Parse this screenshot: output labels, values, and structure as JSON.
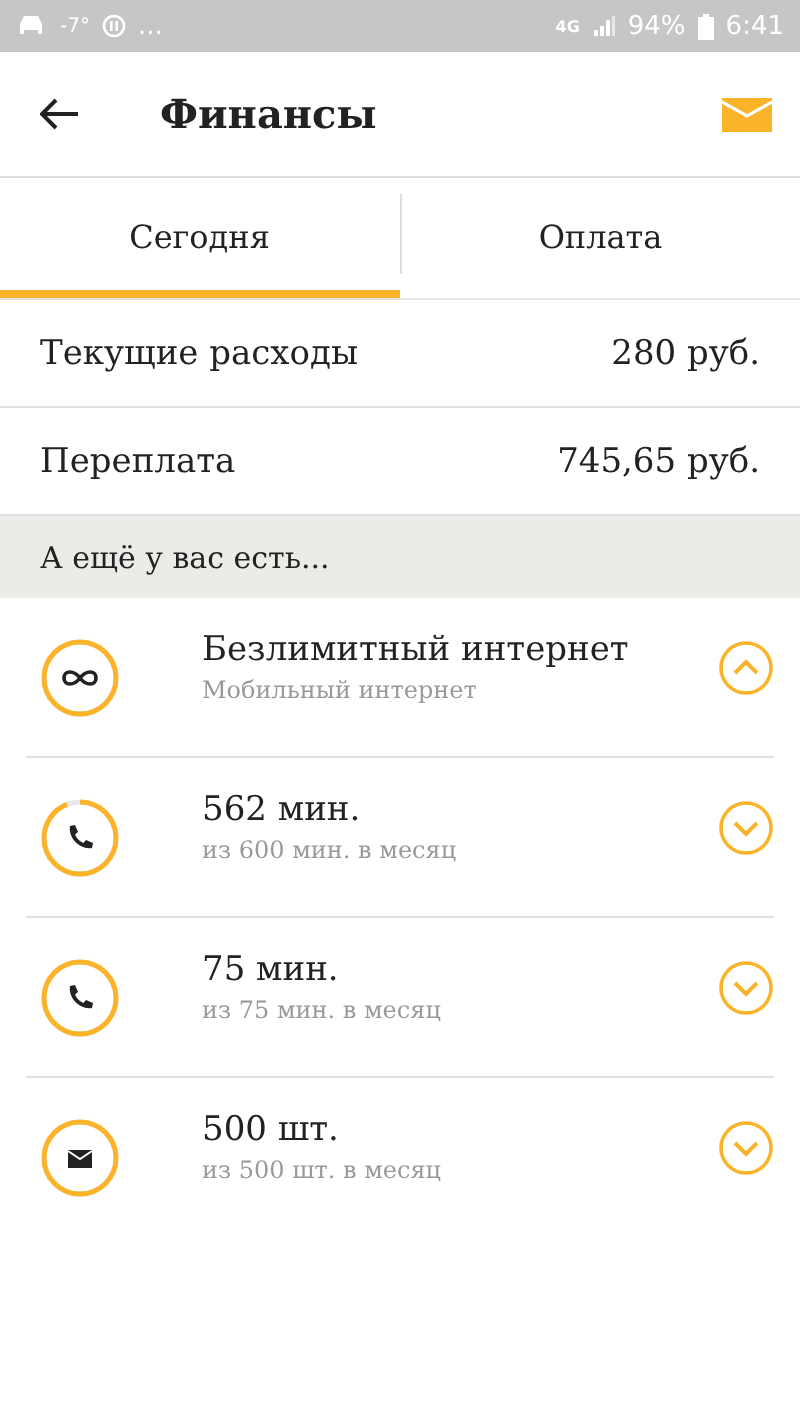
{
  "status_bar": {
    "temperature": "-7°",
    "more": "...",
    "network": "4G",
    "battery": "94%",
    "time": "6:41"
  },
  "app_bar": {
    "title": "Финансы"
  },
  "tabs": [
    {
      "label": "Сегодня",
      "selected": true
    },
    {
      "label": "Оплата",
      "selected": false
    }
  ],
  "summary": [
    {
      "label": "Текущие расходы",
      "value": "280 руб."
    },
    {
      "label": "Переплата",
      "value": "745,65 руб."
    }
  ],
  "section_header": "А ещё у вас есть...",
  "packages": [
    {
      "kind": "infinity",
      "title": "Безлимитный интернет",
      "subtitle": "Мобильный интернет",
      "level": 1,
      "expanded": true
    },
    {
      "kind": "phone",
      "title": "562 мин.",
      "subtitle": "из 600 мин. в месяц",
      "level": 0.94,
      "expanded": false
    },
    {
      "kind": "phone",
      "title": "75 мин.",
      "subtitle": "из 75 мин. в месяц",
      "level": 1,
      "expanded": false
    },
    {
      "kind": "sms",
      "title": "500 шт.",
      "subtitle": "из 500 шт. в месяц",
      "level": 1,
      "expanded": false
    }
  ]
}
